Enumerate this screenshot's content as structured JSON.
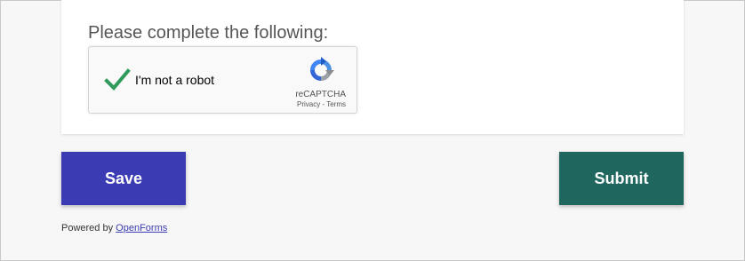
{
  "form": {
    "prompt": "Please complete the following:",
    "captcha": {
      "checkbox_label": "I'm not a robot",
      "brand": "reCAPTCHA",
      "privacy": "Privacy",
      "separator": " - ",
      "terms": "Terms",
      "checked": true
    }
  },
  "actions": {
    "save_label": "Save",
    "submit_label": "Submit"
  },
  "footer": {
    "powered_text": "Powered by ",
    "link_text": "OpenForms"
  },
  "colors": {
    "save": "#3b3bb3",
    "submit": "#1f675e",
    "check": "#2e9a5b"
  }
}
